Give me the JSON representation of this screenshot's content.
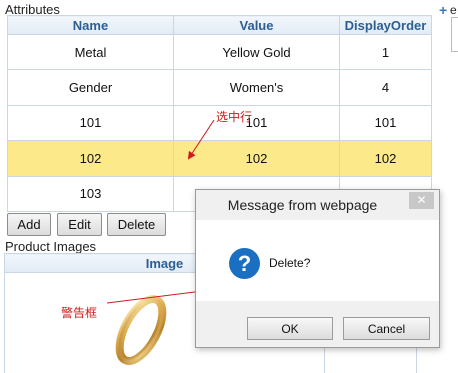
{
  "attributes": {
    "title": "Attributes",
    "columns": [
      "Name",
      "Value",
      "DisplayOrder"
    ],
    "rows": [
      [
        "Metal",
        "Yellow Gold",
        "1"
      ],
      [
        "Gender",
        "Women's",
        "4"
      ],
      [
        "101",
        "101",
        "101"
      ],
      [
        "102",
        "102",
        "102"
      ],
      [
        "103",
        "",
        ""
      ]
    ],
    "selected_row": 3,
    "selected_color": "#fbe98a",
    "buttons": {
      "add": "Add",
      "edit": "Edit",
      "delete": "Delete"
    }
  },
  "product_images": {
    "title": "Product Images",
    "columns": [
      "Image"
    ],
    "image_icon": "gold-ring-image"
  },
  "side_panel": {
    "plus_icon": "+",
    "label": "e"
  },
  "annotations": {
    "selected_row_note": "选中行",
    "alert_box_note": "警告框",
    "color": "#d11a1a"
  },
  "dialog": {
    "title": "Message from webpage",
    "close_icon": "✕",
    "message": "Delete?",
    "icon": "?",
    "ok_label": "OK",
    "cancel_label": "Cancel"
  }
}
